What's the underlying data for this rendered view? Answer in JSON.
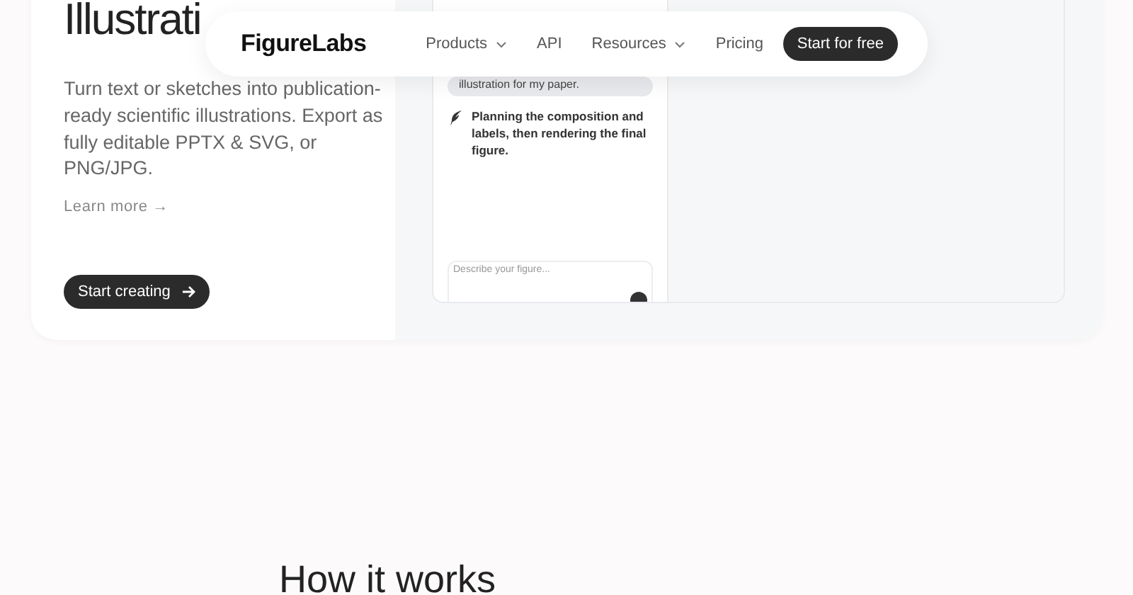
{
  "nav": {
    "logo": "FigureLabs",
    "links": [
      {
        "label": "Products",
        "dropdown": true
      },
      {
        "label": "API",
        "dropdown": false
      },
      {
        "label": "Resources",
        "dropdown": true
      },
      {
        "label": "Pricing",
        "dropdown": false
      }
    ],
    "cta": "Start for free"
  },
  "hero": {
    "title": "Illustrati",
    "description": "Turn text or sketches into publication-ready scientific illustrations. Export as fully editable PPTX & SVG, or PNG/JPG.",
    "learn_more": "Learn more →",
    "button": "Start creating"
  },
  "chat": {
    "user_message": "illustration for my paper.",
    "assistant_message": "Planning the composition and labels, then rendering the final figure.",
    "input": {
      "placeholder": "Describe your figure..."
    }
  },
  "section": {
    "heading": "How it works"
  }
}
